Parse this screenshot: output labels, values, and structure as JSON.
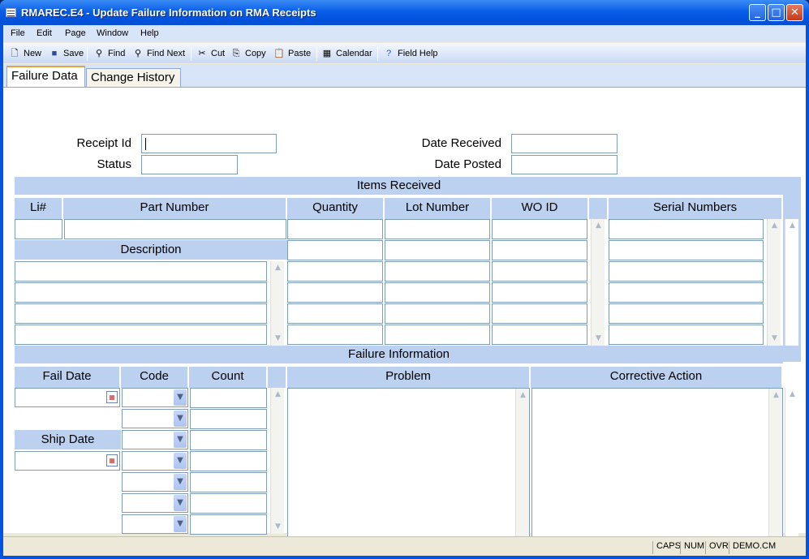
{
  "window": {
    "title": "RMAREC.E4 - Update Failure Information on RMA Receipts"
  },
  "menu": [
    "File",
    "Edit",
    "Page",
    "Window",
    "Help"
  ],
  "toolbar": {
    "new": "New",
    "save": "Save",
    "find": "Find",
    "find_next": "Find Next",
    "cut": "Cut",
    "copy": "Copy",
    "paste": "Paste",
    "calendar": "Calendar",
    "field_help": "Field Help"
  },
  "tabs": {
    "failure_data": "Failure Data",
    "change_history": "Change History"
  },
  "form": {
    "receipt_id_label": "Receipt Id",
    "receipt_id": "",
    "status_label": "Status",
    "status": "",
    "date_received_label": "Date Received",
    "date_received": "",
    "date_posted_label": "Date Posted",
    "date_posted": ""
  },
  "items": {
    "title": "Items Received",
    "col_li": "Li#",
    "col_part": "Part Number",
    "col_qty": "Quantity",
    "col_lot": "Lot Number",
    "col_wo": "WO ID",
    "col_serial": "Serial Numbers",
    "description_label": "Description"
  },
  "failure": {
    "title": "Failure Information",
    "col_fail_date": "Fail Date",
    "col_code": "Code",
    "col_count": "Count",
    "col_problem": "Problem",
    "col_corrective": "Corrective Action",
    "ship_date_label": "Ship Date"
  },
  "status": {
    "caps": "CAPS",
    "num": "NUM",
    "ovr": "OVR",
    "db": "DEMO.CM"
  }
}
